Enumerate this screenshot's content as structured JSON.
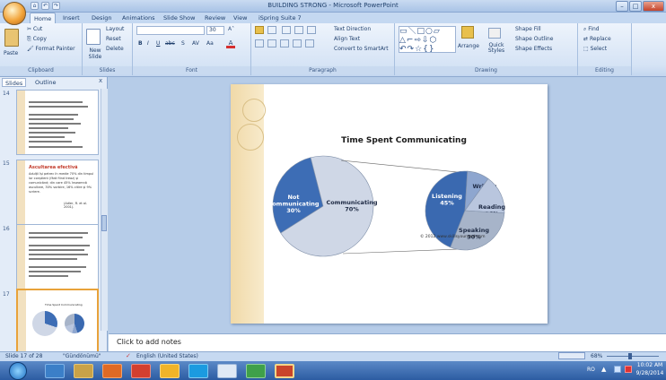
{
  "window": {
    "title": "BUILDING STRONG - Microsoft PowerPoint",
    "minimize": "–",
    "maximize": "□",
    "close": "x"
  },
  "qat": {
    "save": "⌂",
    "undo": "↶",
    "redo": "↷"
  },
  "tabs": [
    "Home",
    "Insert",
    "Design",
    "Animations",
    "Slide Show",
    "Review",
    "View",
    "iSpring Suite 7"
  ],
  "ribbon": {
    "clipboard": {
      "label": "Clipboard",
      "paste": "Paste",
      "cut": "Cut",
      "copy": "Copy",
      "format_painter": "Format Painter"
    },
    "slides": {
      "label": "Slides",
      "new_slide": "New Slide",
      "layout": "Layout",
      "reset": "Reset",
      "delete": "Delete"
    },
    "font": {
      "label": "Font",
      "font_name": "",
      "font_size": "30",
      "bold": "B",
      "italic": "I",
      "underline": "U",
      "strike": "abc",
      "shadow": "S",
      "spacing": "AV",
      "case": "Aa"
    },
    "paragraph": {
      "label": "Paragraph",
      "text_direction": "Text Direction",
      "align_text": "Align Text",
      "smartart": "Convert to SmartArt"
    },
    "drawing": {
      "label": "Drawing",
      "arrange": "Arrange",
      "quick_styles": "Quick Styles",
      "shape_fill": "Shape Fill",
      "shape_outline": "Shape Outline",
      "shape_effects": "Shape Effects"
    },
    "editing": {
      "label": "Editing",
      "find": "Find",
      "replace": "Replace",
      "select": "Select"
    }
  },
  "left_pane": {
    "tabs": [
      "Slides",
      "Outline"
    ],
    "close": "x",
    "slides": [
      {
        "number": "14"
      },
      {
        "number": "15",
        "title": "Ascultarea efectivă",
        "body": "Adulții își petrec în medie 70% din timpul lor conștient (fără fiind treaz) și comunicând; din care 45% înseamnă ascultare, 30% vorbire, 16% citire și 9% scriere.",
        "cite": "(Adler, R. et al. 2001)."
      },
      {
        "number": "16"
      },
      {
        "number": "17",
        "title": "Time Spent Communicating"
      }
    ]
  },
  "slide": {
    "chart": {
      "title": "Time Spent Communicating",
      "main_pie": [
        {
          "label": "Not Communicating",
          "value": "30%",
          "color": "#3d6db5"
        },
        {
          "label": "Communicating",
          "value": "70%",
          "color": "#cfd7e6"
        }
      ],
      "breakdown": [
        {
          "label": "Listening",
          "value": "45%",
          "color": "#3a69b0"
        },
        {
          "label": "Writing",
          "value": "9%",
          "color": "#8ea6cf"
        },
        {
          "label": "Reading",
          "value": "16%",
          "color": "#b9c6de"
        },
        {
          "label": "Speaking",
          "value": "30%",
          "color": "#a7b4c9"
        }
      ],
      "copyright": "© 2012 www.skillsyouneed.com"
    }
  },
  "notes": {
    "placeholder": "Click to add notes"
  },
  "status": {
    "slide": "Slide 17 of 28",
    "theme": "\"Gündönümü\"",
    "language": "English (United States)",
    "zoom": "68%"
  },
  "taskbar": {
    "lang": "RO",
    "time": "10:02 AM",
    "date": "9/28/2014"
  },
  "colors": {
    "accent": "#3d6db5",
    "ribbon": "#dce8f7",
    "taskbar": "#2c5ca2"
  }
}
